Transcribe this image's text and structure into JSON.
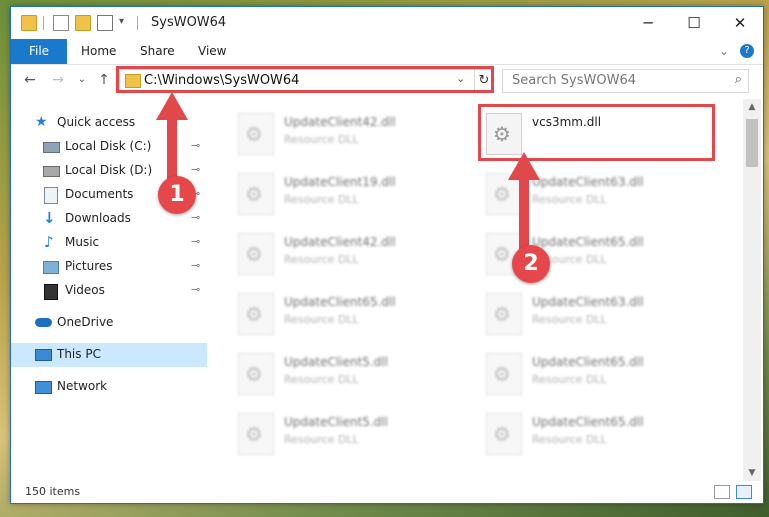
{
  "window": {
    "title": "SysWOW64",
    "minimize": "─",
    "maximize": "☐",
    "close": "✕"
  },
  "ribbon": {
    "file": "File",
    "tabs": [
      "Home",
      "Share",
      "View"
    ],
    "expand": "⌄",
    "help": "?"
  },
  "address": {
    "back": "←",
    "forward": "→",
    "recent": "⌄",
    "up": "↑",
    "path": "C:\\Windows\\SysWOW64",
    "dropdown": "⌄",
    "refresh": "↻"
  },
  "search": {
    "placeholder": "Search SysWOW64",
    "icon": "⌕"
  },
  "sidebar": {
    "quick_access": "Quick access",
    "items": [
      {
        "label": "Local Disk (C:)",
        "icon": "drive-icon",
        "pinned": true
      },
      {
        "label": "Local Disk (D:)",
        "icon": "drive-icon",
        "pinned": true
      },
      {
        "label": "Documents",
        "icon": "documents-icon",
        "pinned": true
      },
      {
        "label": "Downloads",
        "icon": "downloads-icon",
        "pinned": true
      },
      {
        "label": "Music",
        "icon": "music-icon",
        "pinned": true
      },
      {
        "label": "Pictures",
        "icon": "pictures-icon",
        "pinned": true
      },
      {
        "label": "Videos",
        "icon": "videos-icon",
        "pinned": true
      }
    ],
    "onedrive": "OneDrive",
    "this_pc": "This PC",
    "network": "Network",
    "pin_glyph": "📌"
  },
  "files": {
    "left_column": [
      {
        "name": "UpdateClient42.dll",
        "type": "Resource DLL"
      },
      {
        "name": "UpdateClient19.dll",
        "type": "Resource DLL"
      },
      {
        "name": "UpdateClient42.dll",
        "type": "Resource DLL"
      },
      {
        "name": "UpdateClient65.dll",
        "type": "Resource DLL"
      },
      {
        "name": "UpdateClient5.dll",
        "type": "Resource DLL"
      },
      {
        "name": "UpdateClient5.dll",
        "type": "Resource DLL"
      }
    ],
    "right_column": [
      {
        "name": "vcs3mm.dll",
        "type": ""
      },
      {
        "name": "UpdateClient63.dll",
        "type": "Resource DLL"
      },
      {
        "name": "UpdateClient65.dll",
        "type": "Resource DLL"
      },
      {
        "name": "UpdateClient63.dll",
        "type": "Resource DLL"
      },
      {
        "name": "UpdateClient65.dll",
        "type": "Resource DLL"
      },
      {
        "name": "UpdateClient65.dll",
        "type": "Resource DLL"
      }
    ]
  },
  "status": {
    "item_count": "150 items"
  },
  "callouts": {
    "step1": "1",
    "step2": "2",
    "color": "#e0484b"
  },
  "colors": {
    "accent": "#1979ca",
    "selection": "#cce8ff"
  }
}
